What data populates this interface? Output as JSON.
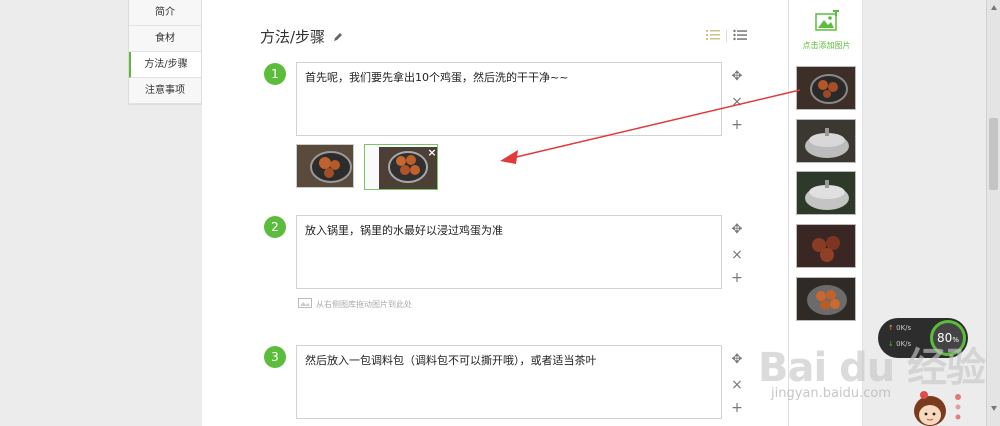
{
  "nav": {
    "items": [
      {
        "label": "简介"
      },
      {
        "label": "食材"
      },
      {
        "label": "方法/步骤"
      },
      {
        "label": "注意事项"
      }
    ],
    "active": "方法/步骤"
  },
  "section": {
    "title": "方法/步骤"
  },
  "steps": [
    {
      "number": "1",
      "text": "首先呢，我们要先拿出10个鸡蛋，然后洗的干干净~~"
    },
    {
      "number": "2",
      "text": "放入锅里，锅里的水最好以浸过鸡蛋为准",
      "hint": "从右侧图库拖动图片到此处"
    },
    {
      "number": "3",
      "text": "然后放入一包调料包（调料包不可以撕开哦），或者适当茶叶"
    }
  ],
  "gallery": {
    "add_label": "点击添加图片"
  },
  "speed_widget": {
    "up": "0K/s",
    "down": "0K/s",
    "percent": "80",
    "unit": "%"
  },
  "watermark": {
    "brand": "Bai du 经验",
    "url": "jingyan.baidu.com"
  },
  "colors": {
    "accent": "#5cbd3c",
    "arrow": "#e03a3a"
  }
}
